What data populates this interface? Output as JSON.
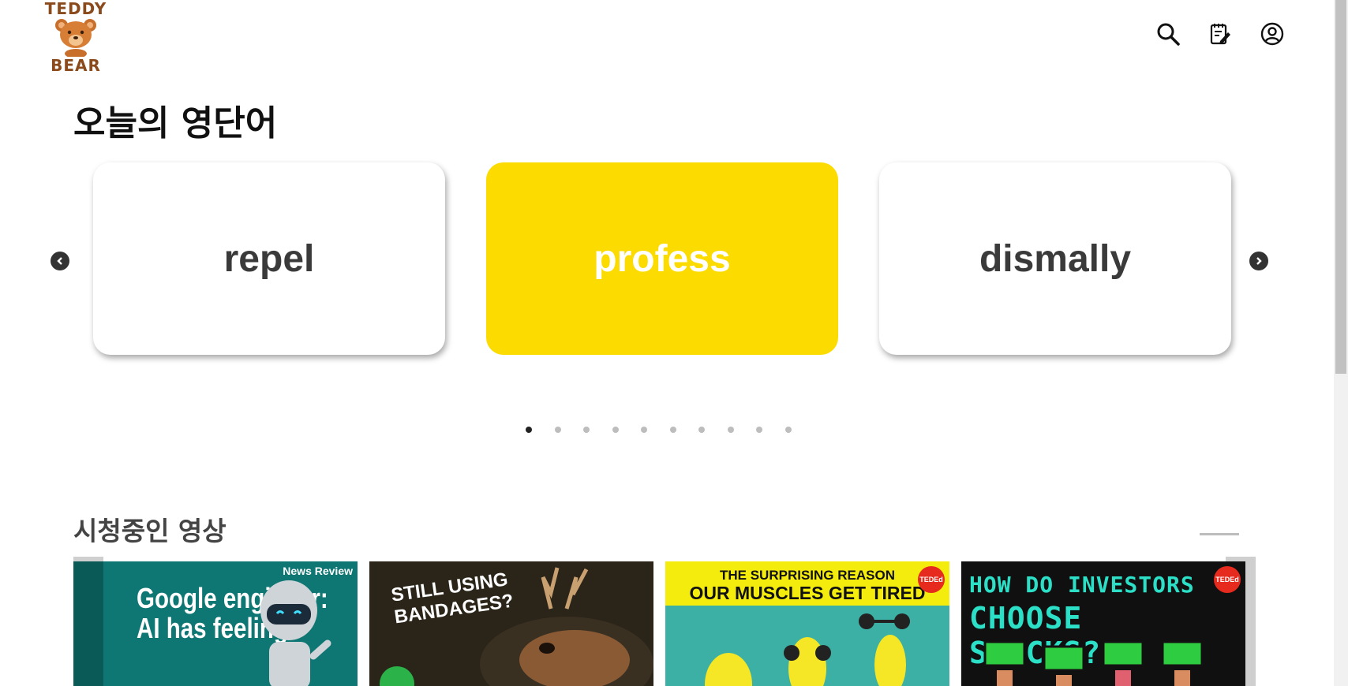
{
  "logo": {
    "top_text": "TEDDY",
    "bottom_text": "BEAR"
  },
  "header": {
    "icons": [
      "search-icon",
      "notebook-edit-icon",
      "user-account-icon"
    ]
  },
  "word_section": {
    "title": "오늘의 영단어",
    "cards": [
      {
        "word": "repel",
        "active": false
      },
      {
        "word": "profess",
        "active": true
      },
      {
        "word": "dismally",
        "active": false
      }
    ],
    "dots_count": 10,
    "active_dot": 1
  },
  "video_section": {
    "title": "시청중인 영상",
    "videos": [
      {
        "badge": "News Review",
        "title": "Google engineer: AI has feelings"
      },
      {
        "title": "STILL USING BANDAGES?"
      },
      {
        "badge": "TEDEd",
        "line1": "THE SURPRISING REASON",
        "line2": "OUR MUSCLES GET TIRED"
      },
      {
        "badge": "TEDEd",
        "line1": "HOW DO INVESTORS",
        "line2": "CHOOSE STOCKS?"
      }
    ]
  },
  "colors": {
    "accent": "#fbdb00",
    "logo_brown": "#8a4a1c",
    "card_text": "#3a3a3a"
  }
}
